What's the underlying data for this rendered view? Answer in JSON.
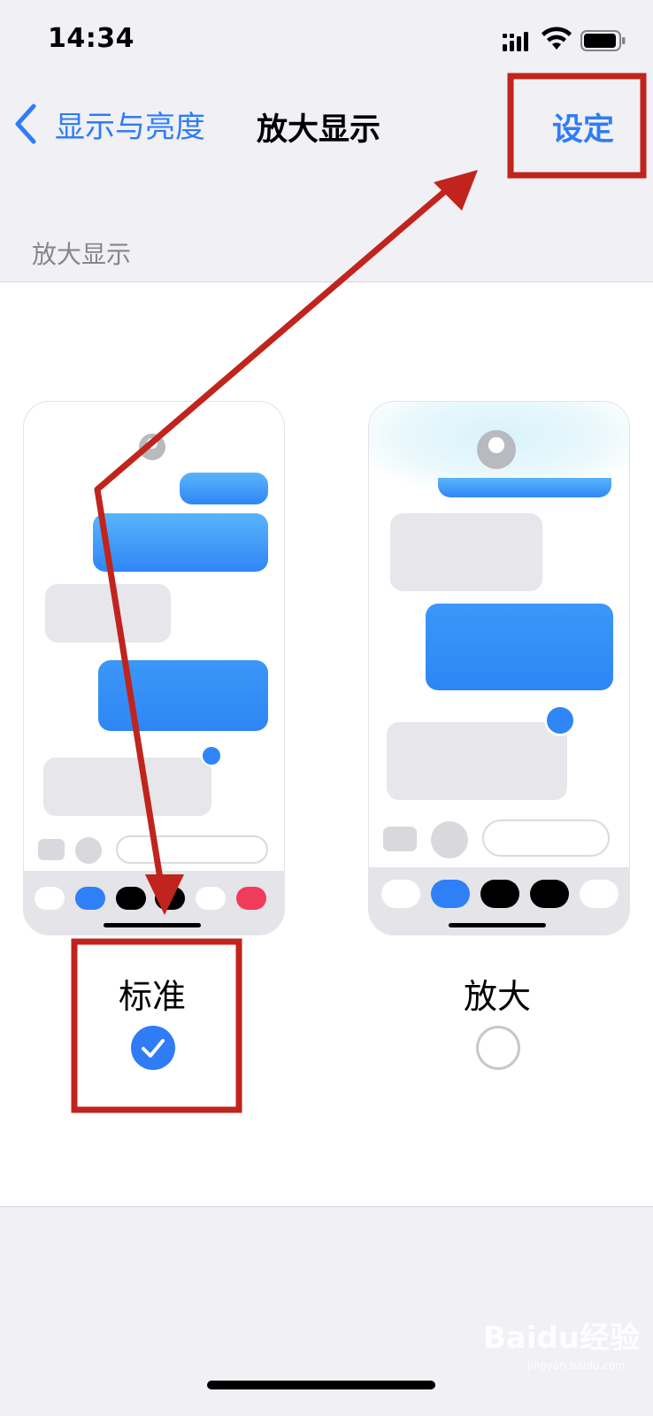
{
  "status_bar": {
    "time": "14:34"
  },
  "nav": {
    "back_label": "显示与亮度",
    "title": "放大显示",
    "action_label": "设定"
  },
  "section": {
    "header": "放大显示"
  },
  "options": [
    {
      "label": "标准",
      "selected": true
    },
    {
      "label": "放大",
      "selected": false
    }
  ],
  "colors": {
    "accent": "#2f7cf6",
    "annotation": "#c0241c",
    "bubble_blue": "#2f86f6",
    "bubble_gray": "#e6e6eb"
  },
  "watermark": {
    "text": "Baidu经验",
    "sub": "jingyan.baidu.com"
  }
}
